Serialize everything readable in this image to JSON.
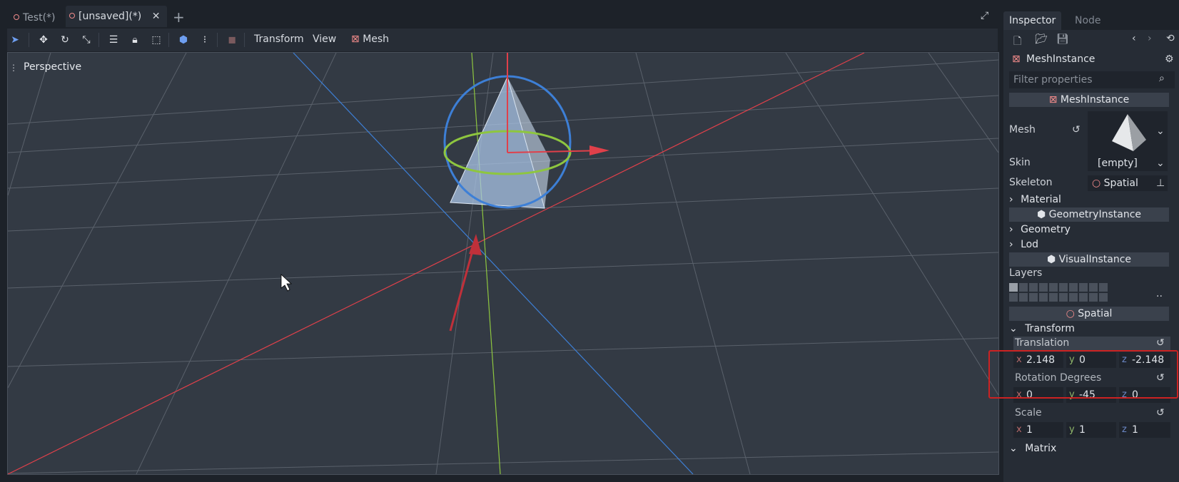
{
  "tabs": [
    {
      "label": "Test(*)",
      "active": false
    },
    {
      "label": "[unsaved](*)",
      "active": true
    }
  ],
  "toolbar": {
    "menus": {
      "transform": "Transform",
      "view": "View",
      "mesh": "Mesh"
    }
  },
  "viewport": {
    "label": "Perspective"
  },
  "inspector": {
    "tabs": {
      "inspector": "Inspector",
      "node": "Node"
    },
    "node_name": "MeshInstance",
    "filter_placeholder": "Filter properties",
    "sections": {
      "mesh_instance": "MeshInstance",
      "geometry_instance": "GeometryInstance",
      "visual_instance": "VisualInstance",
      "spatial": "Spatial"
    },
    "props": {
      "mesh": "Mesh",
      "skin": "Skin",
      "skin_value": "[empty]",
      "skeleton": "Skeleton",
      "skeleton_value": "Spatial",
      "material": "Material",
      "geometry": "Geometry",
      "lod": "Lod",
      "layers": "Layers",
      "layers_more": "..",
      "transform": "Transform",
      "matrix": "Matrix"
    },
    "transform": {
      "translation_label": "Translation",
      "translation": {
        "x": "2.148",
        "y": "0",
        "z": "-2.148"
      },
      "rotation_label": "Rotation Degrees",
      "rotation": {
        "x": "0",
        "y": "-45",
        "z": "0"
      },
      "scale_label": "Scale",
      "scale": {
        "x": "1",
        "y": "1",
        "z": "1"
      }
    },
    "axis_letters": {
      "x": "x",
      "y": "y",
      "z": "z"
    }
  },
  "colors": {
    "highlight": "#cc2222",
    "accent": "#6e9ef0",
    "x_axis": "#e0404a",
    "y_axis": "#8ec63f",
    "z_axis": "#3d7fd6"
  }
}
